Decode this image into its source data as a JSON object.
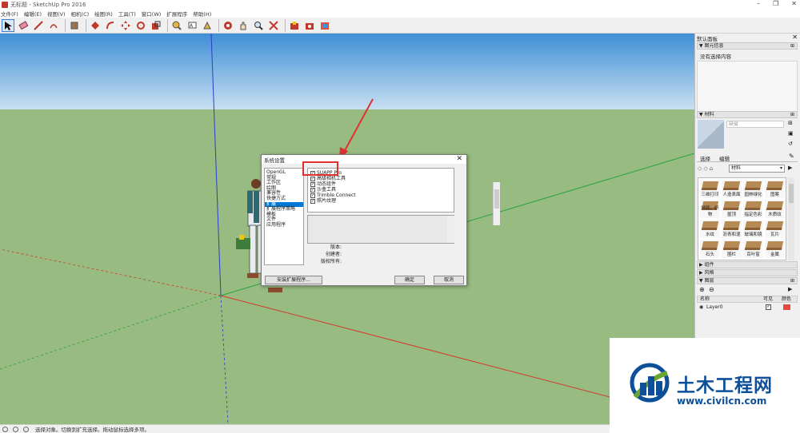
{
  "window": {
    "title": "无标题 - SketchUp Pro 2016",
    "minimize": "–",
    "maximize": "❐",
    "close": "✕"
  },
  "menu": [
    "文件(F)",
    "编辑(E)",
    "视图(V)",
    "相机(C)",
    "绘图(R)",
    "工具(T)",
    "窗口(W)",
    "扩展程序",
    "帮助(H)"
  ],
  "toolbar": {
    "icons": [
      "select-tool-icon",
      "eraser-icon",
      "line-tool-icon",
      "shape-tool-icon",
      "paint-bucket-icon",
      "push-pull-icon",
      "follow-me-icon",
      "move-icon",
      "rotate-icon",
      "scale-icon",
      "tape-measure-icon",
      "text-icon",
      "paint-icon",
      "orbit-icon",
      "pan-icon",
      "zoom-icon",
      "zoom-extents-icon",
      "warehouse-icon",
      "extension-warehouse-icon",
      "layout-icon"
    ]
  },
  "dialog": {
    "title": "系统设置",
    "close": "✕",
    "categories": [
      {
        "label": "OpenGL",
        "active": false
      },
      {
        "label": "常规",
        "active": false
      },
      {
        "label": "工作区",
        "active": false
      },
      {
        "label": "绘图",
        "active": false
      },
      {
        "label": "兼容性",
        "active": false
      },
      {
        "label": "快捷方式",
        "active": false
      },
      {
        "label": "扩展",
        "active": true
      },
      {
        "label": "扩展程序策略",
        "active": false
      },
      {
        "label": "模板",
        "active": false
      },
      {
        "label": "文件",
        "active": false
      },
      {
        "label": "应用程序",
        "active": false
      }
    ],
    "extensions": [
      {
        "label": "SUAPP Pro",
        "checked": true
      },
      {
        "label": "高级相机工具",
        "checked": true
      },
      {
        "label": "动态组件",
        "checked": true
      },
      {
        "label": "沙盒工具",
        "checked": true
      },
      {
        "label": "Trimble Connect",
        "checked": true
      },
      {
        "label": "照片纹理",
        "checked": true
      }
    ],
    "version_label": "版本:",
    "creator_label": "创建者:",
    "copyright_label": "版权所有:",
    "install_button": "安装扩展程序...",
    "ok_button": "确定",
    "cancel_button": "取消"
  },
  "panel": {
    "title": "默认面板",
    "close": "✕",
    "entity_info": {
      "header": "图元信息",
      "text": "没有选择内容"
    },
    "materials": {
      "header": "材料",
      "name_value": "缺省",
      "tab_select": "选择",
      "tab_edit": "编辑",
      "category": "材料",
      "items": [
        "三维打印",
        "人造表面",
        "园林绿化",
        "图案",
        "地毯、织物",
        "屋顶",
        "指定色彩",
        "木质纹",
        "水纹",
        "沥青和混",
        "玻璃和镜",
        "瓦片",
        "石头",
        "围栏",
        "百叶窗",
        "金属"
      ]
    },
    "components_header": "组件",
    "styles_header": "风格",
    "layers": {
      "header": "图层",
      "col_name": "名称",
      "col_visible": "可见",
      "col_color": "颜色",
      "rows": [
        {
          "name": "Layer0",
          "visible": true,
          "color": "#e8483c"
        }
      ]
    }
  },
  "status": {
    "text": "选择对象。切换到扩充选择。拖动鼠标选择多项。"
  },
  "watermark": {
    "title": "土木工程网",
    "url": "www.civilcn.com"
  }
}
